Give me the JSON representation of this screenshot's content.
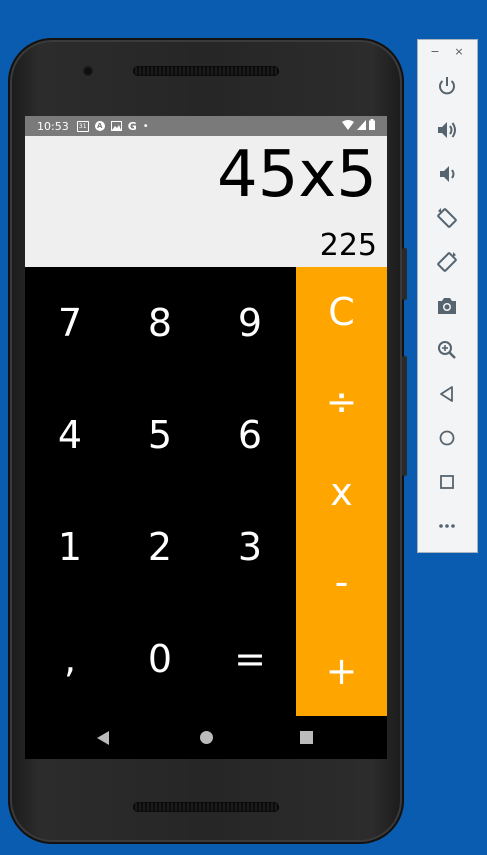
{
  "status_bar": {
    "time": "10:53",
    "icons": [
      "sim-icon",
      "a-icon",
      "image-icon",
      "google-icon",
      "dot-icon"
    ],
    "right_icons": [
      "wifi-icon",
      "signal-icon",
      "battery-icon"
    ]
  },
  "display": {
    "expression": "45x5",
    "result": "225"
  },
  "keys": {
    "k7": "7",
    "k8": "8",
    "k9": "9",
    "k4": "4",
    "k5": "5",
    "k6": "6",
    "k1": "1",
    "k2": "2",
    "k3": "3",
    "comma": ",",
    "k0": "0",
    "equals": "="
  },
  "operators": {
    "clear": "C",
    "divide": "÷",
    "multiply": "x",
    "minus": "-",
    "plus": "+"
  },
  "colors": {
    "operator_panel": "#ffa500",
    "keypad": "#000000",
    "display_bg": "#efefef",
    "desktop_bg": "#0a5cb0"
  },
  "emulator_panel": {
    "minimize": "−",
    "close": "×",
    "tools": [
      "power-icon",
      "volume-up-icon",
      "volume-down-icon",
      "rotate-left-icon",
      "rotate-right-icon",
      "screenshot-icon",
      "zoom-icon",
      "back-icon",
      "home-icon",
      "overview-icon",
      "more-icon"
    ]
  }
}
